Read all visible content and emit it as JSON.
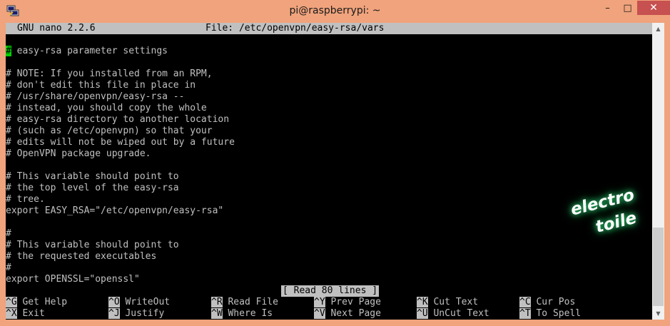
{
  "window": {
    "title": "pi@raspberrypi: ~"
  },
  "controls": {
    "minimize": "–",
    "maximize": "□",
    "close": "✕"
  },
  "icons": {
    "app": "putty-icon"
  },
  "nano": {
    "version": "GNU nano 2.2.6",
    "file": "File: /etc/openvpn/easy-rsa/vars",
    "cursor_char": "#",
    "lines": [
      " easy-rsa parameter settings",
      "",
      "# NOTE: If you installed from an RPM,",
      "# don't edit this file in place in",
      "# /usr/share/openvpn/easy-rsa --",
      "# instead, you should copy the whole",
      "# easy-rsa directory to another location",
      "# (such as /etc/openvpn) so that your",
      "# edits will not be wiped out by a future",
      "# OpenVPN package upgrade.",
      "",
      "# This variable should point to",
      "# the top level of the easy-rsa",
      "# tree.",
      "export EASY_RSA=\"/etc/openvpn/easy-rsa\"",
      "",
      "#",
      "# This variable should point to",
      "# the requested executables",
      "#",
      "export OPENSSL=\"openssl\""
    ],
    "message": "[ Read 80 lines ]",
    "shortcuts": [
      [
        {
          "key": "^G",
          "label": "Get Help"
        },
        {
          "key": "^O",
          "label": "WriteOut"
        },
        {
          "key": "^R",
          "label": "Read File"
        },
        {
          "key": "^Y",
          "label": "Prev Page"
        },
        {
          "key": "^K",
          "label": "Cut Text"
        },
        {
          "key": "^C",
          "label": "Cur Pos"
        }
      ],
      [
        {
          "key": "^X",
          "label": "Exit"
        },
        {
          "key": "^J",
          "label": "Justify"
        },
        {
          "key": "^W",
          "label": "Where Is"
        },
        {
          "key": "^V",
          "label": "Next Page"
        },
        {
          "key": "^U",
          "label": "UnCut Text"
        },
        {
          "key": "^T",
          "label": "To Spell"
        }
      ]
    ]
  },
  "watermark": {
    "line1": "electro",
    "line2": "toile"
  }
}
